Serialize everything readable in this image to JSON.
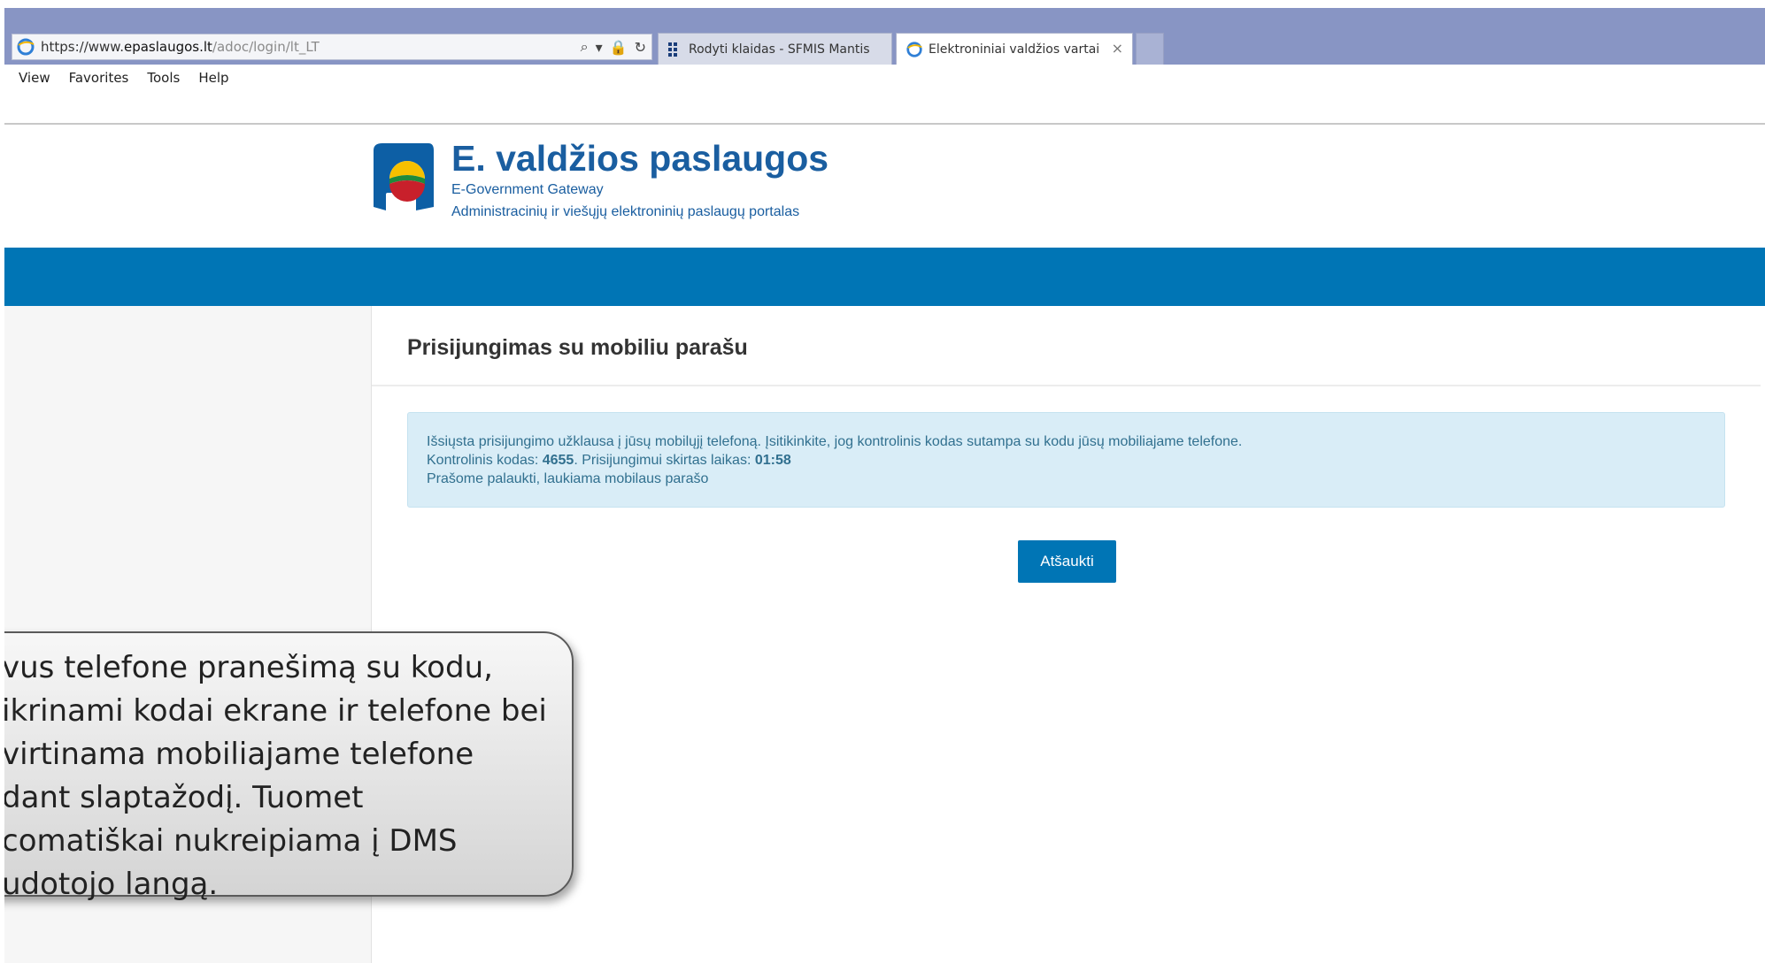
{
  "browser": {
    "url": {
      "scheme": "https://www.",
      "domain": "epaslaugos.lt",
      "path": "/adoc/login/lt_LT"
    },
    "tabs": [
      {
        "label": "Rodyti klaidas - SFMIS Mantis"
      },
      {
        "label": "Elektroniniai valdžios vartai",
        "close": "×"
      }
    ],
    "menu": {
      "view": "View",
      "favorites": "Favorites",
      "tools": "Tools",
      "help": "Help"
    }
  },
  "header": {
    "title": "E. valdžios paslaugos",
    "subtitle": "E-Government Gateway",
    "tagline": "Administracinių ir viešųjų elektroninių paslaugų portalas"
  },
  "panel": {
    "title": "Prisijungimas su mobiliu parašu",
    "alert": {
      "line1": "Išsiųsta prisijungimo užklausa į jūsų mobilųjį telefoną. Įsitikinkite, jog kontrolinis kodas sutampa su kodu jūsų mobiliajame telefone.",
      "code_label": "Kontrolinis kodas: ",
      "code_value": "4655",
      "time_label": ". Prisijungimui skirtas laikas: ",
      "time_value": "01:58",
      "line3": "Prašome palaukti, laukiama mobilaus parašo"
    },
    "cancel_button": "Atšaukti"
  },
  "callout": {
    "lines": [
      "vus telefone pranešimą su kodu,",
      "ikrinami kodai ekrane ir telefone bei",
      "virtinama mobiliajame telefone",
      "dant slaptažodį. Tuomet",
      "comatiškai nukreipiama į DMS",
      "udotojo langą."
    ]
  },
  "colors": {
    "brand_blue": "#0075b5",
    "title_blue": "#1a5ea0",
    "alert_bg": "#d9edf7",
    "alert_text": "#31708f",
    "tabbar": "#8895c4"
  }
}
